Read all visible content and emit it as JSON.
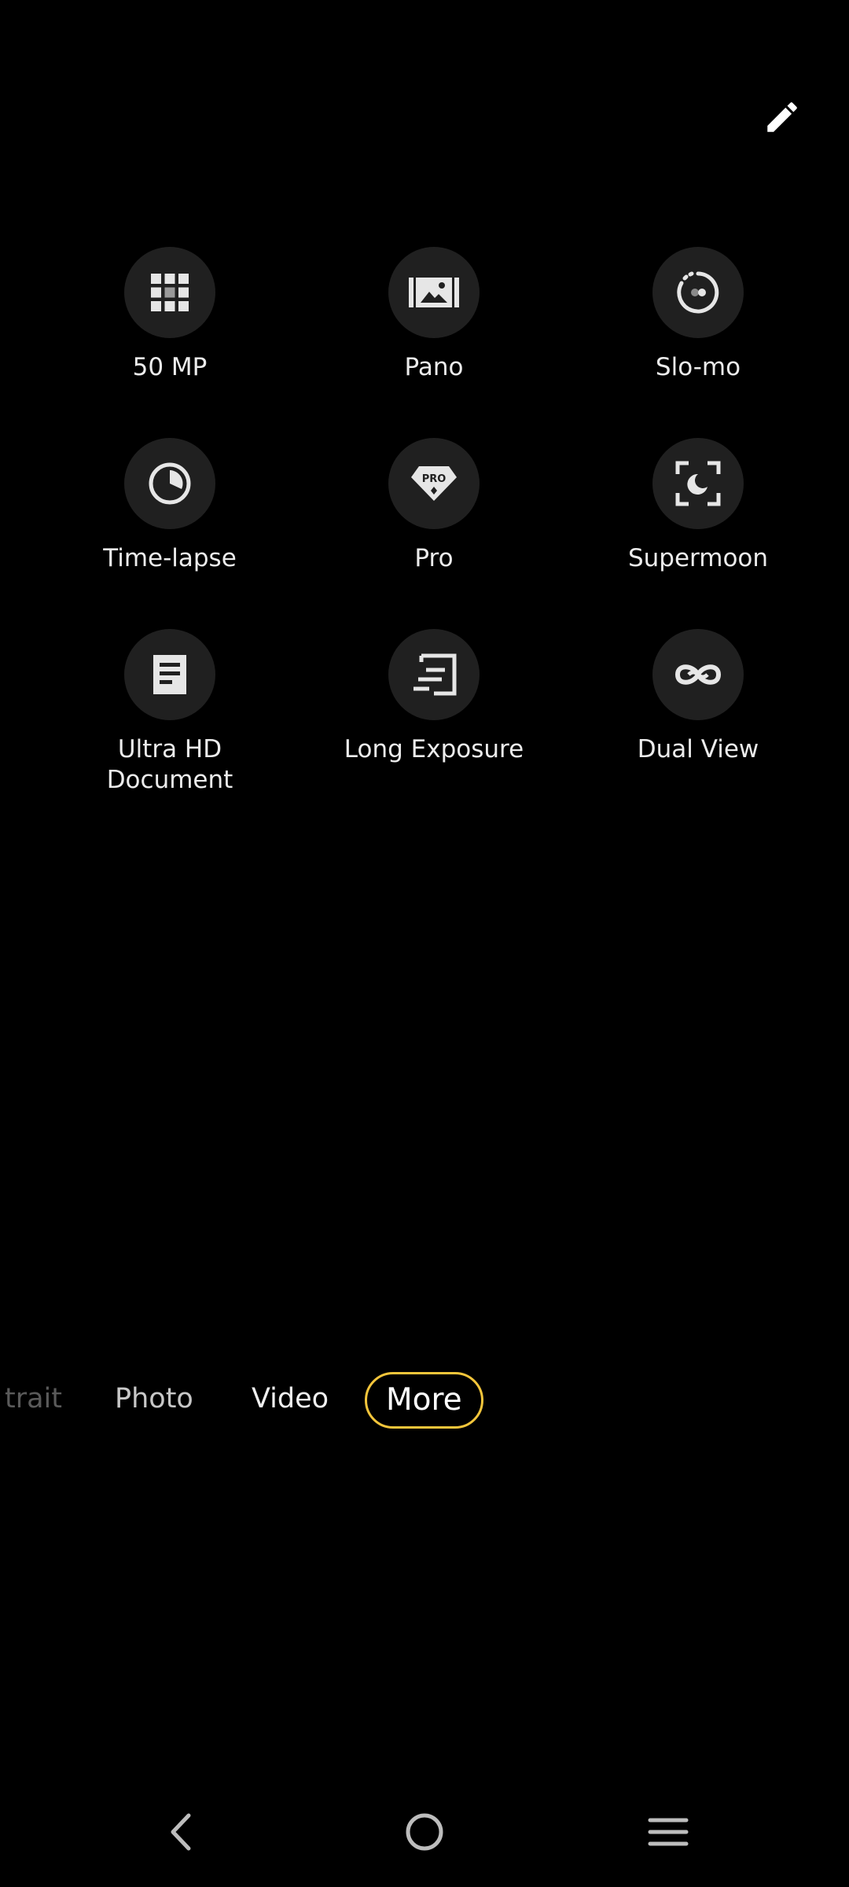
{
  "header": {
    "edit_icon": "pencil-icon"
  },
  "modes": [
    {
      "label": "50 MP",
      "icon": "grid-icon"
    },
    {
      "label": "Pano",
      "icon": "panorama-icon"
    },
    {
      "label": "Slo-mo",
      "icon": "slow-motion-icon"
    },
    {
      "label": "Time-lapse",
      "icon": "clock-icon"
    },
    {
      "label": "Pro",
      "icon": "pro-diamond-icon"
    },
    {
      "label": "Supermoon",
      "icon": "moon-focus-icon"
    },
    {
      "label": "Ultra HD\nDocument",
      "icon": "document-icon"
    },
    {
      "label": "Long Exposure",
      "icon": "long-exposure-icon"
    },
    {
      "label": "Dual View",
      "icon": "infinity-icon"
    }
  ],
  "mode_bar": {
    "tabs": [
      "trait",
      "Photo",
      "Video",
      "More"
    ],
    "active": "More"
  },
  "colors": {
    "background": "#000000",
    "circle": "#202020",
    "accent": "#f3c53b"
  },
  "navbar": {
    "icons": [
      "back-icon",
      "home-icon",
      "menu-icon"
    ]
  }
}
